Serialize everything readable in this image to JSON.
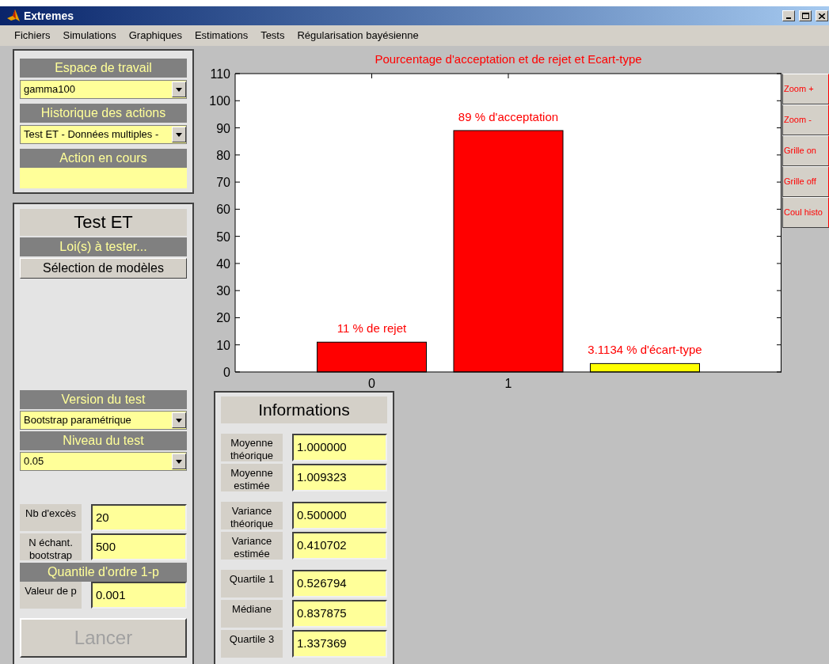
{
  "window": {
    "title": "Extremes"
  },
  "menu": [
    "Fichiers",
    "Simulations",
    "Graphiques",
    "Estimations",
    "Tests",
    "Régularisation bayésienne"
  ],
  "workspace": {
    "header": "Espace de travail",
    "value": "gamma100",
    "history_header": "Historique des actions",
    "history_value": "Test ET - Données multiples -",
    "current_header": "Action en cours"
  },
  "test_panel": {
    "title": "Test ET",
    "laws_header": "Loi(s) à tester...",
    "select_button": "Sélection de modèles",
    "version_header": "Version du test",
    "version_value": "Bootstrap paramétrique",
    "level_header": "Niveau du test",
    "level_value": "0.05",
    "params": [
      {
        "label": "Nb d'excès",
        "value": "20"
      },
      {
        "label": "N échant. bootstrap",
        "value": "500"
      }
    ],
    "quantile_header": "Quantile d'ordre 1-p",
    "p_label": "Valeur de p",
    "p_value": "0.001",
    "run_button": {
      "label": "Lancer",
      "disabled": true
    }
  },
  "chart": {
    "chart_data": {
      "type": "bar",
      "title": "Pourcentage d'acceptation et de rejet et Ecart-type",
      "x": [
        0,
        1,
        2
      ],
      "stacked": true,
      "series": [
        {
          "color": "#ff0000",
          "values": [
            11,
            89,
            null
          ]
        },
        {
          "color": "#ffff00",
          "values": [
            null,
            null,
            3.1
          ]
        }
      ],
      "xlim": [
        -1,
        3
      ],
      "ylim": [
        0,
        110
      ],
      "xticks": [
        0,
        1
      ],
      "yticks": [
        0,
        10,
        20,
        30,
        40,
        50,
        60,
        70,
        80,
        90,
        100,
        110
      ],
      "value_labels": [
        "11 % de rejet",
        "89 % d'acceptation",
        "3.1134 % d'écart-type"
      ]
    }
  },
  "side_buttons": [
    "Zoom +",
    "Zoom -",
    "Grille on",
    "Grille off",
    "Coul histo"
  ],
  "info": {
    "title": "Informations",
    "groups": [
      [
        {
          "label": "Moyenne théorique",
          "value": "1.000000"
        },
        {
          "label": "Moyenne estimée",
          "value": "1.009323"
        }
      ],
      [
        {
          "label": "Variance théorique",
          "value": "0.500000"
        },
        {
          "label": "Variance estimée",
          "value": "0.410702"
        }
      ],
      [
        {
          "label": "Quartile 1",
          "value": "0.526794"
        },
        {
          "label": "Médiane",
          "value": "0.837875"
        },
        {
          "label": "Quartile 3",
          "value": "1.337369"
        }
      ]
    ]
  }
}
